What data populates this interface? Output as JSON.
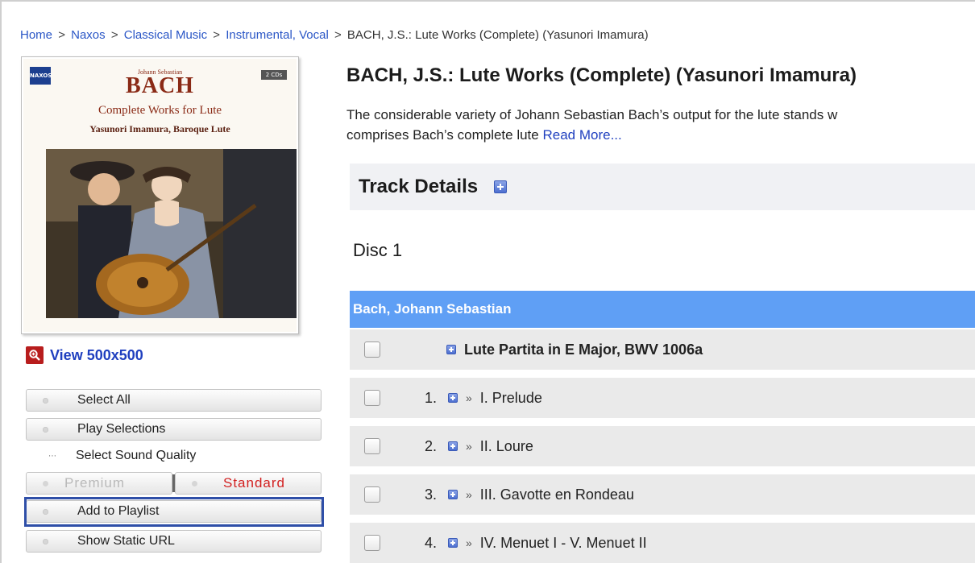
{
  "breadcrumb": {
    "items": [
      "Home",
      "Naxos",
      "Classical Music",
      "Instrumental, Vocal"
    ],
    "current": "BACH, J.S.: Lute Works (Complete) (Yasunori Imamura)"
  },
  "cover": {
    "label": "NAXOS",
    "discs": "2 CDs",
    "composer_small": "Johann Sebastian",
    "composer_big": "BACH",
    "subtitle": "Complete Works for Lute",
    "performer": "Yasunori Imamura, Baroque Lute"
  },
  "view_link": {
    "label": "View 500x500",
    "icon": "zoom-icon"
  },
  "buttons": {
    "select_all": "Select All",
    "play_selections": "Play Selections",
    "select_quality": "Select Sound Quality",
    "premium": "Premium",
    "standard": "Standard",
    "add_playlist": "Add to Playlist",
    "static_url": "Show Static URL"
  },
  "album": {
    "title": "BACH, J.S.: Lute Works (Complete) (Yasunori Imamura)",
    "description": "The considerable variety of Johann Sebastian Bach’s output for the lute stands w",
    "description_line2": "comprises Bach’s complete lute",
    "read_more": "Read More..."
  },
  "track_details": {
    "label": "Track Details"
  },
  "disc": "Disc 1",
  "composer": "Bach, Johann Sebastian",
  "work": "Lute Partita in E Major, BWV 1006a",
  "tracks": [
    {
      "num": "1.",
      "title": "I. Prelude"
    },
    {
      "num": "2.",
      "title": "II. Loure"
    },
    {
      "num": "3.",
      "title": "III. Gavotte en Rondeau"
    },
    {
      "num": "4.",
      "title": "IV. Menuet I - V. Menuet II"
    }
  ],
  "colors": {
    "link": "#2a56c6",
    "composer_bar": "#5f9ff5",
    "highlight": "#2f4fa8",
    "standard": "#d21f1f"
  }
}
